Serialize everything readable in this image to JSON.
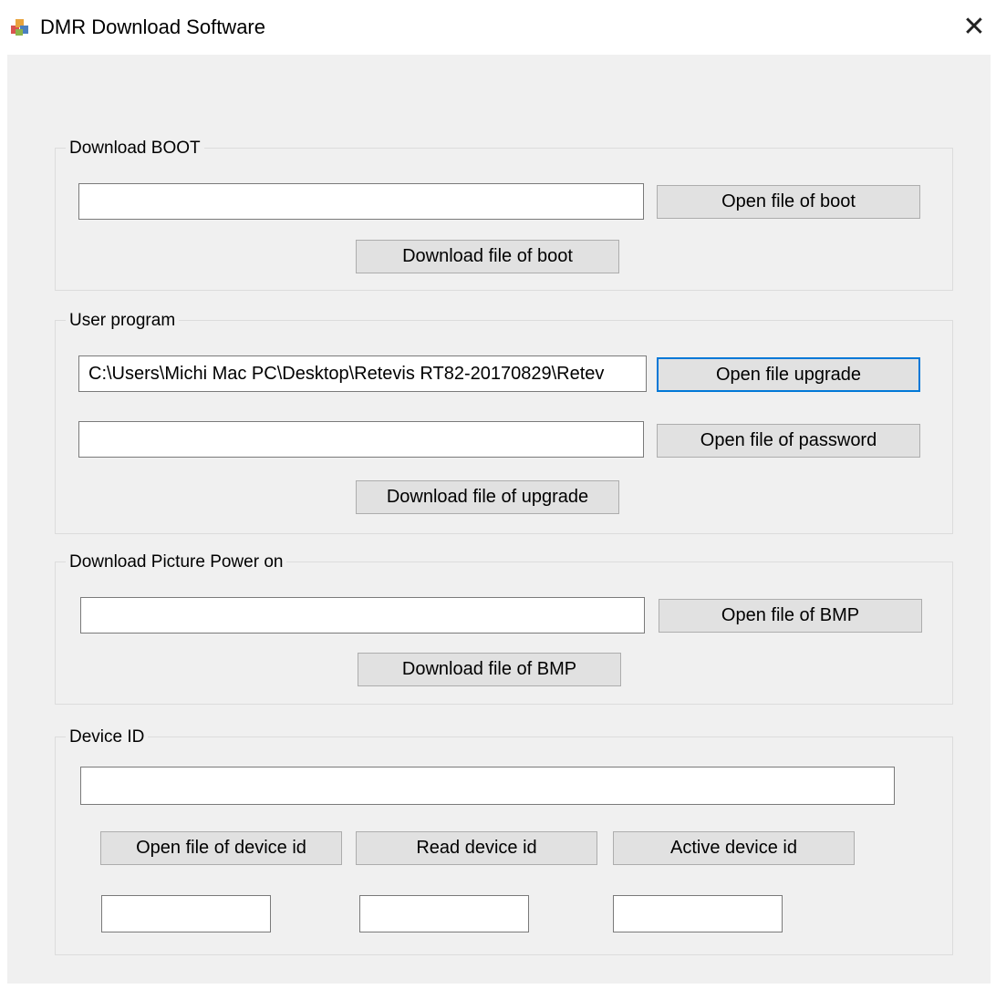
{
  "window": {
    "title": "DMR Download Software",
    "close_glyph": "✕",
    "icon": "dmr-app-icon"
  },
  "boot": {
    "legend": "Download BOOT",
    "path_value": "",
    "open_label": "Open file of boot",
    "download_label": "Download file of boot"
  },
  "user_program": {
    "legend": "User program",
    "upgrade_path_value": "C:\\Users\\Michi Mac PC\\Desktop\\Retevis RT82-20170829\\Retev",
    "open_upgrade_label": "Open file upgrade",
    "password_path_value": "",
    "open_password_label": "Open file of password",
    "download_label": "Download file of upgrade"
  },
  "picture": {
    "legend": "Download Picture Power on",
    "path_value": "",
    "open_label": "Open file of BMP",
    "download_label": "Download file of BMP"
  },
  "device_id": {
    "legend": "Device ID",
    "path_value": "",
    "open_label": "Open file of device id",
    "read_label": "Read device id",
    "active_label": "Active device id",
    "field1_value": "",
    "field2_value": "",
    "field3_value": ""
  },
  "colors": {
    "client_bg": "#f0f0f0",
    "button_bg": "#e1e1e1",
    "focus_border": "#0078d7",
    "group_border": "#dcdcdc"
  }
}
